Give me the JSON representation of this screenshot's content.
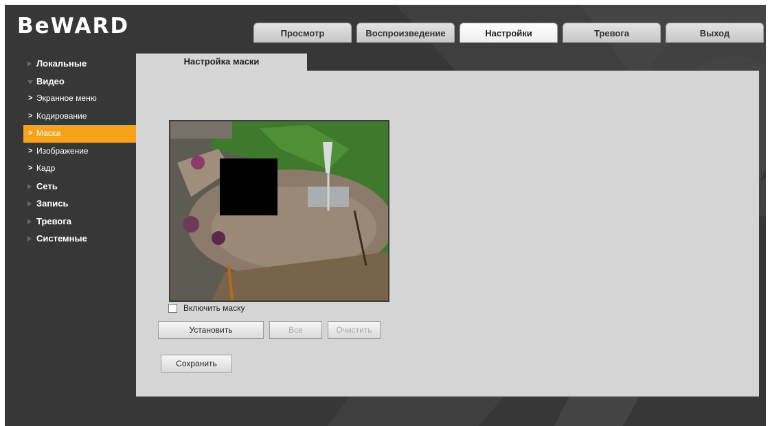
{
  "app": {
    "logo_text": "BeWARD"
  },
  "tabs": [
    {
      "label": "Просмотр",
      "active": false
    },
    {
      "label": "Воспроизведение",
      "active": false
    },
    {
      "label": "Настройки",
      "active": true
    },
    {
      "label": "Тревога",
      "active": false
    },
    {
      "label": "Выход",
      "active": false
    }
  ],
  "sidebar": {
    "items": [
      {
        "label": "Локальные",
        "type": "category",
        "expanded": false
      },
      {
        "label": "Видео",
        "type": "category",
        "expanded": true
      },
      {
        "label": "Экранное меню",
        "type": "sub"
      },
      {
        "label": "Кодирование",
        "type": "sub"
      },
      {
        "label": "Маска",
        "type": "sub",
        "active": true
      },
      {
        "label": "Изображение",
        "type": "sub"
      },
      {
        "label": "Кадр",
        "type": "sub"
      },
      {
        "label": "Сеть",
        "type": "category",
        "expanded": false
      },
      {
        "label": "Запись",
        "type": "category",
        "expanded": false
      },
      {
        "label": "Тревога",
        "type": "category",
        "expanded": false
      },
      {
        "label": "Системные",
        "type": "category",
        "expanded": false
      }
    ]
  },
  "panel": {
    "title": "Настройка маски",
    "enable_mask_label": "Включить маску",
    "enable_mask_checked": false,
    "buttons": {
      "set": "Установить",
      "all": "Все",
      "clear": "Очистить",
      "save": "Сохранить"
    }
  },
  "colors": {
    "accent": "#f6a21b",
    "background": "#373737",
    "panel": "#d5d5d5"
  }
}
